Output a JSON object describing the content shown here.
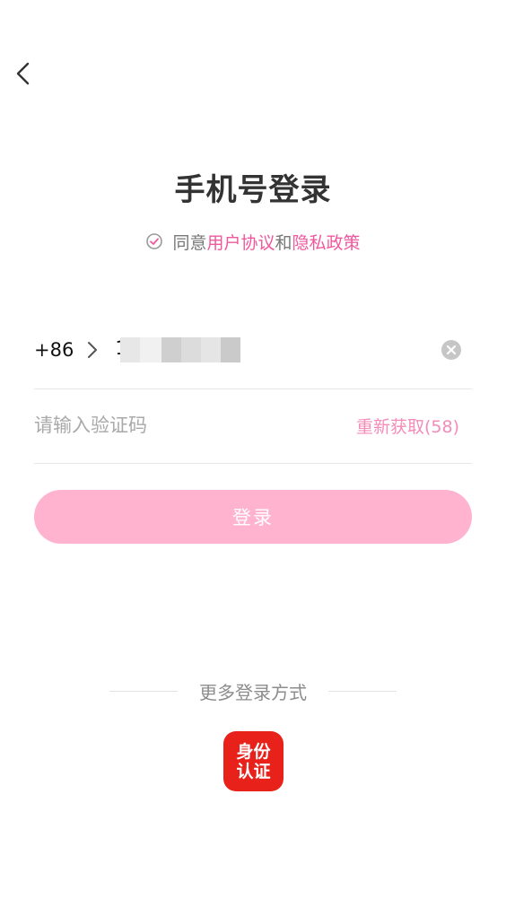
{
  "nav": {
    "back_icon": "chevron-left-icon"
  },
  "header": {
    "title": "手机号登录"
  },
  "agreement": {
    "check_icon": "check-circle-icon",
    "prefix": "同意",
    "link1": "用户协议",
    "middle": "和",
    "link2": "隐私政策"
  },
  "phone": {
    "country_code": "+86",
    "value_visible": "1",
    "clear_icon": "clear-circle-icon"
  },
  "code": {
    "placeholder": "请输入验证码",
    "resend": "重新获取(58)"
  },
  "login": {
    "label": "登录"
  },
  "more": {
    "label": "更多登录方式",
    "id_auth_line1": "身份",
    "id_auth_line2": "认证"
  },
  "colors": {
    "accent": "#f1579d",
    "button": "#ffb3cf",
    "resend": "#f48bb9",
    "id_badge": "#e8221b"
  }
}
